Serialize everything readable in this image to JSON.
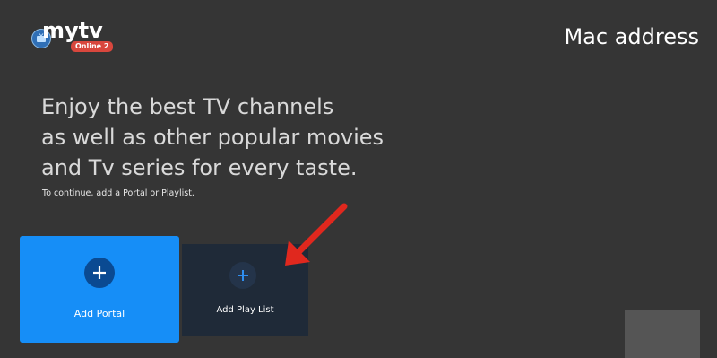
{
  "app": {
    "logo_text": "mytv",
    "logo_badge": "Online 2",
    "logo_icon": "tv-icon"
  },
  "header": {
    "mac_address_label": "Mac address"
  },
  "intro": {
    "headline_lines": [
      "Enjoy the best TV channels",
      "as well as other popular movies",
      "and Tv series for every taste."
    ],
    "instruction": "To continue, add a Portal or Playlist."
  },
  "actions": [
    {
      "label": "Add Portal",
      "icon": "plus-icon",
      "selected": true
    },
    {
      "label": "Add Play List",
      "icon": "plus-icon",
      "selected": false
    }
  ],
  "colors": {
    "background": "#353535",
    "selected_card": "#168ef7",
    "unselected_card": "#1f2a38",
    "arrow": "#e0281e",
    "logo_badge": "#d8473d"
  }
}
